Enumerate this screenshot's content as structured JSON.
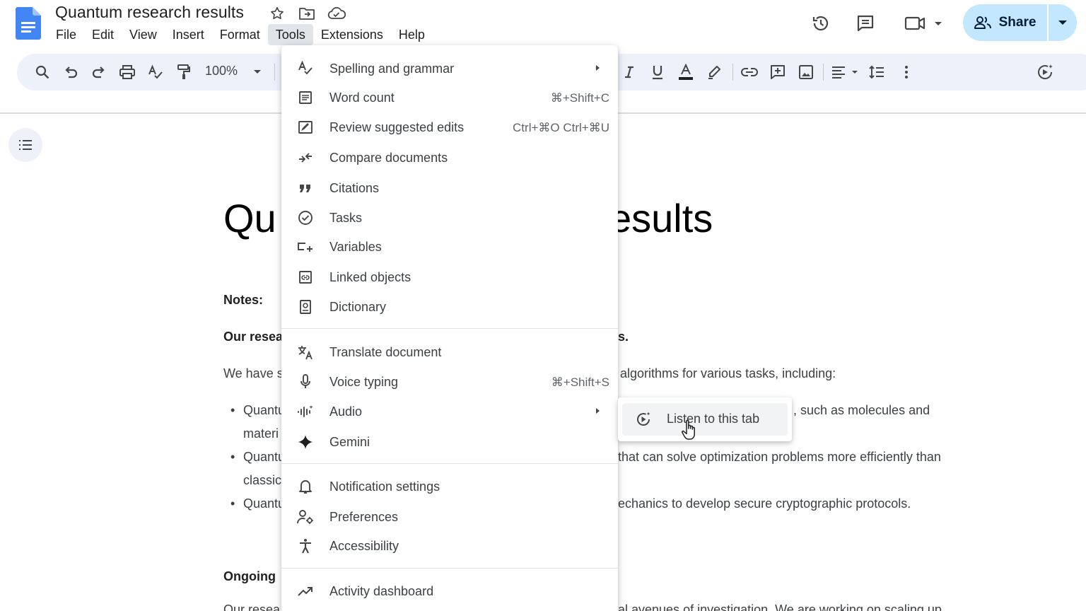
{
  "header": {
    "doc_title": "Quantum research results",
    "menus": [
      "File",
      "Edit",
      "View",
      "Insert",
      "Format",
      "Tools",
      "Extensions",
      "Help"
    ],
    "active_menu": "Tools",
    "share_label": "Share"
  },
  "toolbar": {
    "zoom": "100%"
  },
  "document": {
    "title_left": "Qu",
    "title_right": "esults",
    "notes_label": "Notes:",
    "bold_line_left": "Our resea",
    "bold_line_right": "s.",
    "para_left": "We have s",
    "para_right": "algorithms for various tasks, including:",
    "bullets": [
      {
        "left": "Quantu",
        "right": ", such as molecules and",
        "cont_left": "materi"
      },
      {
        "left": "Quantu",
        "right": "that can solve optimization problems more efficiently than",
        "cont_left": "classic"
      },
      {
        "left": "Quantu",
        "right": "echanics to develop secure cryptographic protocols."
      }
    ],
    "ongoing_label": "Ongoing",
    "last_left": "Our resea",
    "last_right": "al avenues of investigation. We are working on scaling up"
  },
  "tools_menu": {
    "items": [
      {
        "label": "Spelling and grammar",
        "icon": "spellcheck-icon",
        "shortcut": "",
        "submenu": true
      },
      {
        "label": "Word count",
        "icon": "word-count-icon",
        "shortcut": "⌘+Shift+C",
        "submenu": false
      },
      {
        "label": "Review suggested edits",
        "icon": "review-edits-icon",
        "shortcut": "Ctrl+⌘O Ctrl+⌘U",
        "submenu": false
      },
      {
        "label": "Compare documents",
        "icon": "compare-icon",
        "shortcut": "",
        "submenu": false
      },
      {
        "label": "Citations",
        "icon": "quote-icon",
        "shortcut": "",
        "submenu": false
      },
      {
        "label": "Tasks",
        "icon": "task-check-icon",
        "shortcut": "",
        "submenu": false
      },
      {
        "label": "Variables",
        "icon": "variables-icon",
        "shortcut": "",
        "submenu": false
      },
      {
        "label": "Linked objects",
        "icon": "linked-objects-icon",
        "shortcut": "",
        "submenu": false
      },
      {
        "label": "Dictionary",
        "icon": "dictionary-icon",
        "shortcut": "",
        "submenu": false
      },
      {
        "label": "Translate document",
        "icon": "translate-icon",
        "shortcut": "",
        "submenu": false
      },
      {
        "label": "Voice typing",
        "icon": "microphone-icon",
        "shortcut": "⌘+Shift+S",
        "submenu": false
      },
      {
        "label": "Audio",
        "icon": "audio-wave-icon",
        "shortcut": "",
        "submenu": true
      },
      {
        "label": "Gemini",
        "icon": "gemini-sparkle-icon",
        "shortcut": "",
        "submenu": false
      },
      {
        "label": "Notification settings",
        "icon": "bell-icon",
        "shortcut": "",
        "submenu": false
      },
      {
        "label": "Preferences",
        "icon": "preferences-icon",
        "shortcut": "",
        "submenu": false
      },
      {
        "label": "Accessibility",
        "icon": "accessibility-icon",
        "shortcut": "",
        "submenu": false
      },
      {
        "label": "Activity dashboard",
        "icon": "trending-up-icon",
        "shortcut": "",
        "submenu": false
      }
    ]
  },
  "audio_submenu": {
    "item_label": "Listen to this tab",
    "icon": "listen-play-icon"
  },
  "colors": {
    "share_bg": "#c2e7ff",
    "toolbar_bg": "#edf2fa",
    "docs_blue": "#4285f4",
    "active_menu_bg": "#e1e5ea"
  }
}
